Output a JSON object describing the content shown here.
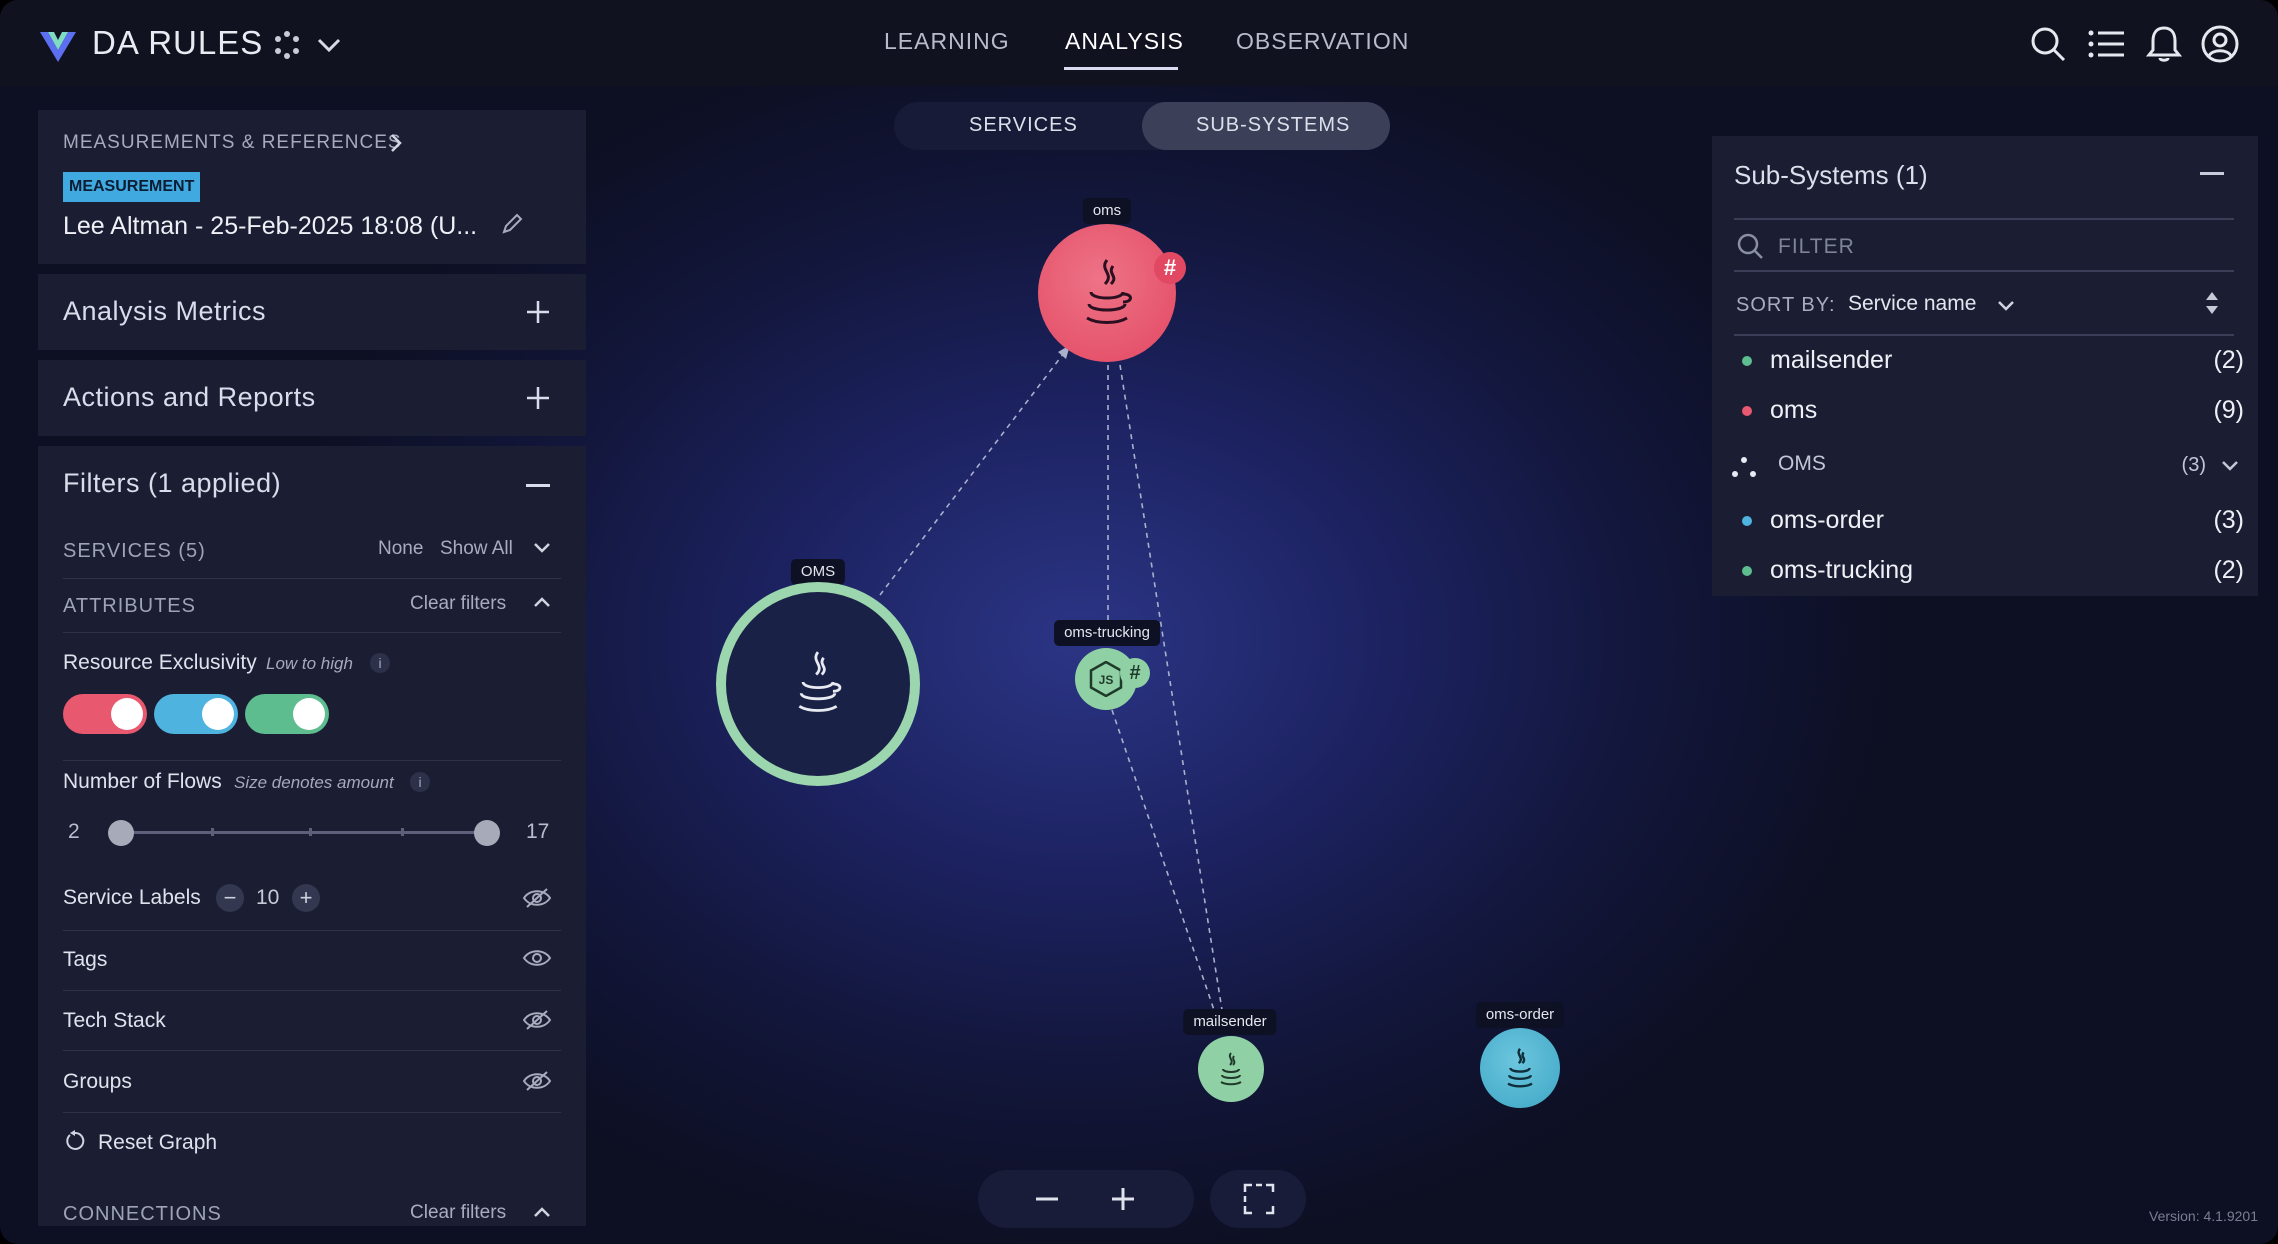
{
  "app": {
    "title": "DA RULES"
  },
  "nav": {
    "tabs": [
      "LEARNING",
      "ANALYSIS",
      "OBSERVATION"
    ],
    "active": "ANALYSIS"
  },
  "left_panel": {
    "breadcrumb": "MEASUREMENTS & REFERENCES",
    "badge": "MEASUREMENT",
    "measurement_name": "Lee Altman - 25-Feb-2025 18:08 (U...",
    "analysis_metrics": "Analysis Metrics",
    "actions_reports": "Actions and Reports",
    "filters": {
      "title": "Filters (1 applied)",
      "services_label": "SERVICES (5)",
      "services_none": "None",
      "services_show_all": "Show All",
      "attributes_label": "ATTRIBUTES",
      "clear_filters": "Clear filters",
      "resource_exclusivity": "Resource Exclusivity",
      "resource_exclusivity_hint": "Low to high",
      "toggles": [
        {
          "name": "red",
          "color": "#e8586e",
          "on": true
        },
        {
          "name": "blue",
          "color": "#4fb3df",
          "on": true
        },
        {
          "name": "green",
          "color": "#5dbd8f",
          "on": true
        }
      ],
      "number_of_flows": "Number of Flows",
      "number_of_flows_hint": "Size denotes amount",
      "flows_min": "2",
      "flows_max": "17",
      "service_labels": "Service Labels",
      "service_labels_value": "10",
      "tags": "Tags",
      "tech_stack": "Tech Stack",
      "groups": "Groups",
      "reset_graph": "Reset Graph",
      "connections_label": "CONNECTIONS",
      "connections_clear": "Clear filters"
    },
    "info_glyph": "i"
  },
  "view_toggle": {
    "options": [
      "SERVICES",
      "SUB-SYSTEMS"
    ],
    "active": "SUB-SYSTEMS"
  },
  "graph": {
    "nodes": [
      {
        "id": "oms",
        "label": "oms",
        "color": "#e8586e",
        "hash": "#"
      },
      {
        "id": "OMS",
        "label": "OMS",
        "color": "#9bd6ae"
      },
      {
        "id": "oms-trucking",
        "label": "oms-trucking",
        "color": "#8fd1a4",
        "hash": "#"
      },
      {
        "id": "mailsender",
        "label": "mailsender",
        "color": "#8fd1a4"
      },
      {
        "id": "oms-order",
        "label": "oms-order",
        "color": "#4fb3cf"
      }
    ]
  },
  "right_panel": {
    "title": "Sub-Systems (1)",
    "filter_placeholder": "FILTER",
    "sort_label": "SORT BY:",
    "sort_value": "Service name",
    "items": [
      {
        "name": "mailsender",
        "count": "(2)",
        "color": "#5dbd8f"
      },
      {
        "name": "oms",
        "count": "(9)",
        "color": "#e8586e"
      },
      {
        "name": "OMS",
        "count": "(3)",
        "color": "#ffffff"
      },
      {
        "name": "oms-order",
        "count": "(3)",
        "color": "#4fb3df"
      },
      {
        "name": "oms-trucking",
        "count": "(2)",
        "color": "#5dbd8f"
      }
    ]
  },
  "footer": {
    "version": "Version: 4.1.9201"
  }
}
